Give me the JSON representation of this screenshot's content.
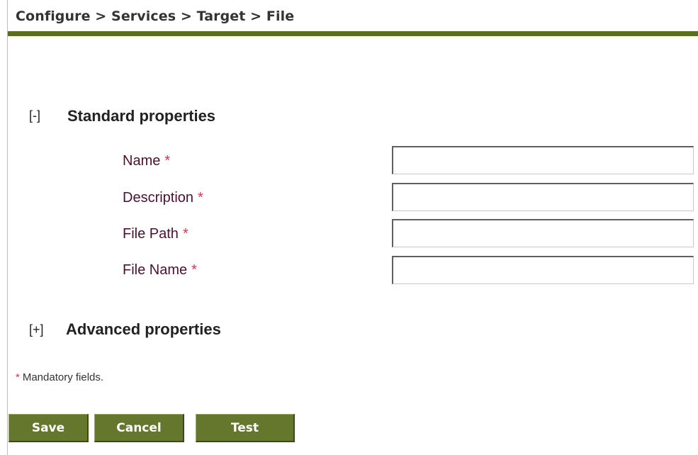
{
  "header": {
    "breadcrumb": "Configure > Services > Target > File",
    "accent_color": "#5a6e1f"
  },
  "standard_section": {
    "toggle": "[-]",
    "title": "Standard properties",
    "fields": [
      {
        "label": "Name",
        "required_marker": "*",
        "value": ""
      },
      {
        "label": "Description",
        "required_marker": "*",
        "value": ""
      },
      {
        "label": "File Path",
        "required_marker": "*",
        "value": ""
      },
      {
        "label": "File Name",
        "required_marker": "*",
        "value": ""
      }
    ]
  },
  "advanced_section": {
    "toggle": "[+]",
    "title": "Advanced properties"
  },
  "footer": {
    "required_marker": "*",
    "mandatory_note": "Mandatory fields."
  },
  "buttons": {
    "save_label": "Save",
    "cancel_label": "Cancel",
    "test_label": "Test",
    "button_color": "#65772d"
  }
}
